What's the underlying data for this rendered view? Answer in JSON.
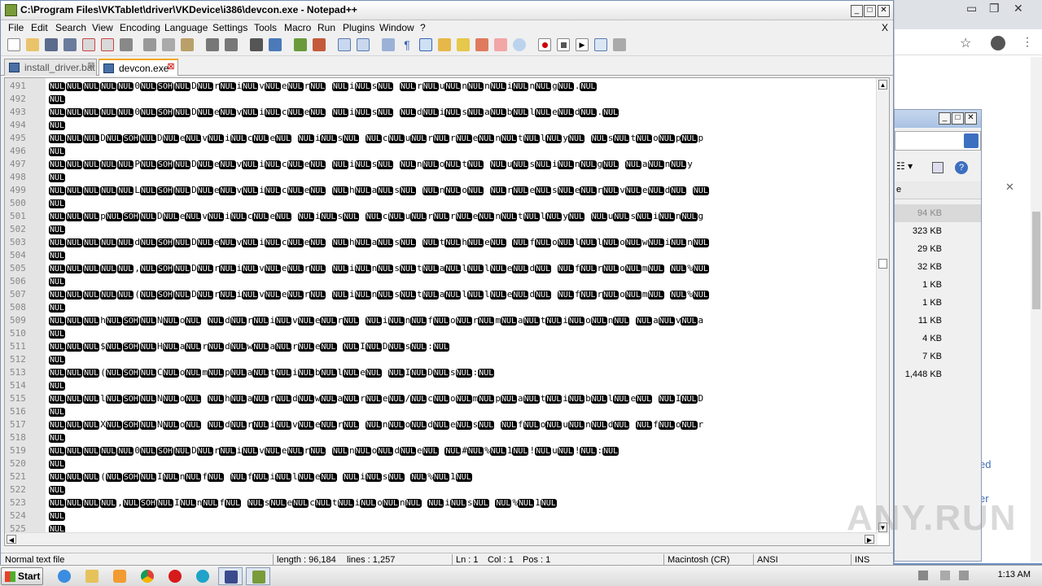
{
  "window": {
    "title": "C:\\Program Files\\VKTablet\\driver\\VKDevice\\i386\\devcon.exe - Notepad++",
    "min": "_",
    "max": "□",
    "close": "✕",
    "menu_close": "X"
  },
  "menu": [
    "File",
    "Edit",
    "Search",
    "View",
    "Encoding",
    "Language",
    "Settings",
    "Tools",
    "Macro",
    "Run",
    "Plugins",
    "Window",
    "?"
  ],
  "tabs": [
    {
      "label": "install_driver.bat",
      "active": false
    },
    {
      "label": "devcon.exe",
      "active": true
    }
  ],
  "editor": {
    "lines": [
      {
        "n": "491",
        "text": "NULNULNULNULNUL0NULSOHNULDNULrNULiNULvNULeNULrNUL NULiNULsNUL NULrNULuNULnNULnNULiNULnNULgNUL.NUL"
      },
      {
        "n": "492",
        "text": "NUL"
      },
      {
        "n": "493",
        "text": "NULNULNULNULNUL0NULSOHNULDNULeNULvNULiNULcNULeNUL NULiNULsNUL NULdNULiNULsNULaNULbNULlNULeNULdNUL.NUL"
      },
      {
        "n": "494",
        "text": "NUL"
      },
      {
        "n": "495",
        "text": "NULNULNULDNULSOHNULDNULeNULvNULiNULcNULeNUL NULiNULsNUL NULcNULuNULrNULrNULeNULnNULtNULlNULyNUL NULsNULtNULoNULpNULp"
      },
      {
        "n": "496",
        "text": "NUL"
      },
      {
        "n": "497",
        "text": "NULNULNULNULNULPNULSOHNULDNULeNULvNULiNULcNULeNUL NULiNULsNUL NULnNULoNULtNUL NULuNULsNULiNULnNULgNUL NULaNULnNULy"
      },
      {
        "n": "498",
        "text": "NUL"
      },
      {
        "n": "499",
        "text": "NULNULNULNULNULLNULSOHNULDNULeNULvNULiNULcNULeNUL NULhNULaNULsNUL NULnNULoNUL NULrNULeNULsNULeNULrNULvNULeNULdNUL NUL"
      },
      {
        "n": "500",
        "text": "NUL"
      },
      {
        "n": "501",
        "text": "NULNULNULpNULSOHNULDNULeNULvNULiNULcNULeNUL NULiNULsNUL NULcNULuNULrNULrNULeNULnNULtNULlNULyNUL NULuNULsNULiNULnNULg"
      },
      {
        "n": "502",
        "text": "NUL"
      },
      {
        "n": "503",
        "text": "NULNULNULNULNULdNULSOHNULDNULeNULvNULiNULcNULeNUL NULhNULaNULsNUL NULtNULhNULeNUL NULfNULoNULlNULlNULoNULwNULiNULnNUL"
      },
      {
        "n": "504",
        "text": "NUL"
      },
      {
        "n": "505",
        "text": "NULNULNULNULNUL,NULSOHNULDNULrNULiNULvNULeNULrNUL NULiNULnNULsNULtNULaNULlNULlNULeNULdNUL NULfNULrNULoNULmNUL NUL%NUL"
      },
      {
        "n": "506",
        "text": "NUL"
      },
      {
        "n": "507",
        "text": "NULNULNULNULNUL(NULSOHNULDNULrNULiNULvNULeNULrNUL NULiNULnNULsNULtNULaNULlNULlNULeNULdNUL NULfNULrNULoNULmNUL NUL%NUL"
      },
      {
        "n": "508",
        "text": "NUL"
      },
      {
        "n": "509",
        "text": "NULNULNULhNULSOHNULNNULoNUL NULdNULrNULiNULvNULeNULrNUL NULiNULnNULfNULoNULrNULmNULaNULtNULiNULoNULnNUL NULaNULvNULa"
      },
      {
        "n": "510",
        "text": "NUL"
      },
      {
        "n": "511",
        "text": "NULNULNUL$NULSOHNULHNULaNULrNULdNULwNULaNULrNULeNUL NULINULDNULsNUL:NUL"
      },
      {
        "n": "512",
        "text": "NUL"
      },
      {
        "n": "513",
        "text": "NULNULNUL(NULSOHNULCNULoNULmNULpNULaNULtNULiNULbNULlNULeNUL NULINULDNULsNUL:NUL"
      },
      {
        "n": "514",
        "text": "NUL"
      },
      {
        "n": "515",
        "text": "NULNULNULlNULSOHNULNNULoNUL NULhNULaNULrNULdNULwNULaNULrNULeNUL/NULcNULoNULmNULpNULaNULtNULiNULbNULlNULeNUL NULINULD"
      },
      {
        "n": "516",
        "text": "NUL"
      },
      {
        "n": "517",
        "text": "NULNULNULXNULSOHNULNNULoNUL NULdNULrNULiNULvNULeNULrNUL NULnNULoNULdNULeNULsNUL NULfNULoNULuNULnNULdNUL NULfNULoNULr"
      },
      {
        "n": "518",
        "text": "NUL"
      },
      {
        "n": "519",
        "text": "NULNULNULNULNUL0NULSOHNULDNULrNULiNULvNULeNULrNUL NULnNULoNULdNULeNUL NUL#NUL%NUL1NUL!NULuNUL!NUL:NUL"
      },
      {
        "n": "520",
        "text": "NUL"
      },
      {
        "n": "521",
        "text": "NULNULNUL(NULSOHNULINULnNULfNUL NULfNULiNULlNULeNUL NULiNULsNUL NUL%NUL1NUL"
      },
      {
        "n": "522",
        "text": "NUL"
      },
      {
        "n": "523",
        "text": "NULNULNULNUL,NULSOHNULINULnNULfNUL NULsNULeNULcNULtNULiNULoNULnNUL NULiNULsNUL NUL%NUL1NUL"
      },
      {
        "n": "524",
        "text": "NUL"
      },
      {
        "n": "525",
        "text": "NUL"
      }
    ]
  },
  "status": {
    "file_type": "Normal text file",
    "length": "length : 96,184",
    "lines": "lines : 1,257",
    "ln": "Ln : 1",
    "col": "Col : 1",
    "pos": "Pos : 1",
    "eol": "Macintosh (CR)",
    "encoding": "ANSI",
    "mode": "INS"
  },
  "explorer": {
    "header": "e",
    "sizes": [
      "94 KB",
      "323 KB",
      "29 KB",
      "32 KB",
      "1 KB",
      "1 KB",
      "11 KB",
      "4 KB",
      "7 KB",
      "1,448 KB"
    ]
  },
  "browser": {
    "side_text": [
      "ed",
      "er"
    ],
    "close_x": "✕"
  },
  "taskbar": {
    "start": "Start",
    "clock": "1:13 AM"
  },
  "watermark": "ANY.RUN",
  "colors": {
    "nul_bg": "#000000",
    "nul_fg": "#ffffff",
    "gutter": "#e4e4e4",
    "accent": "#3f6cb8"
  }
}
